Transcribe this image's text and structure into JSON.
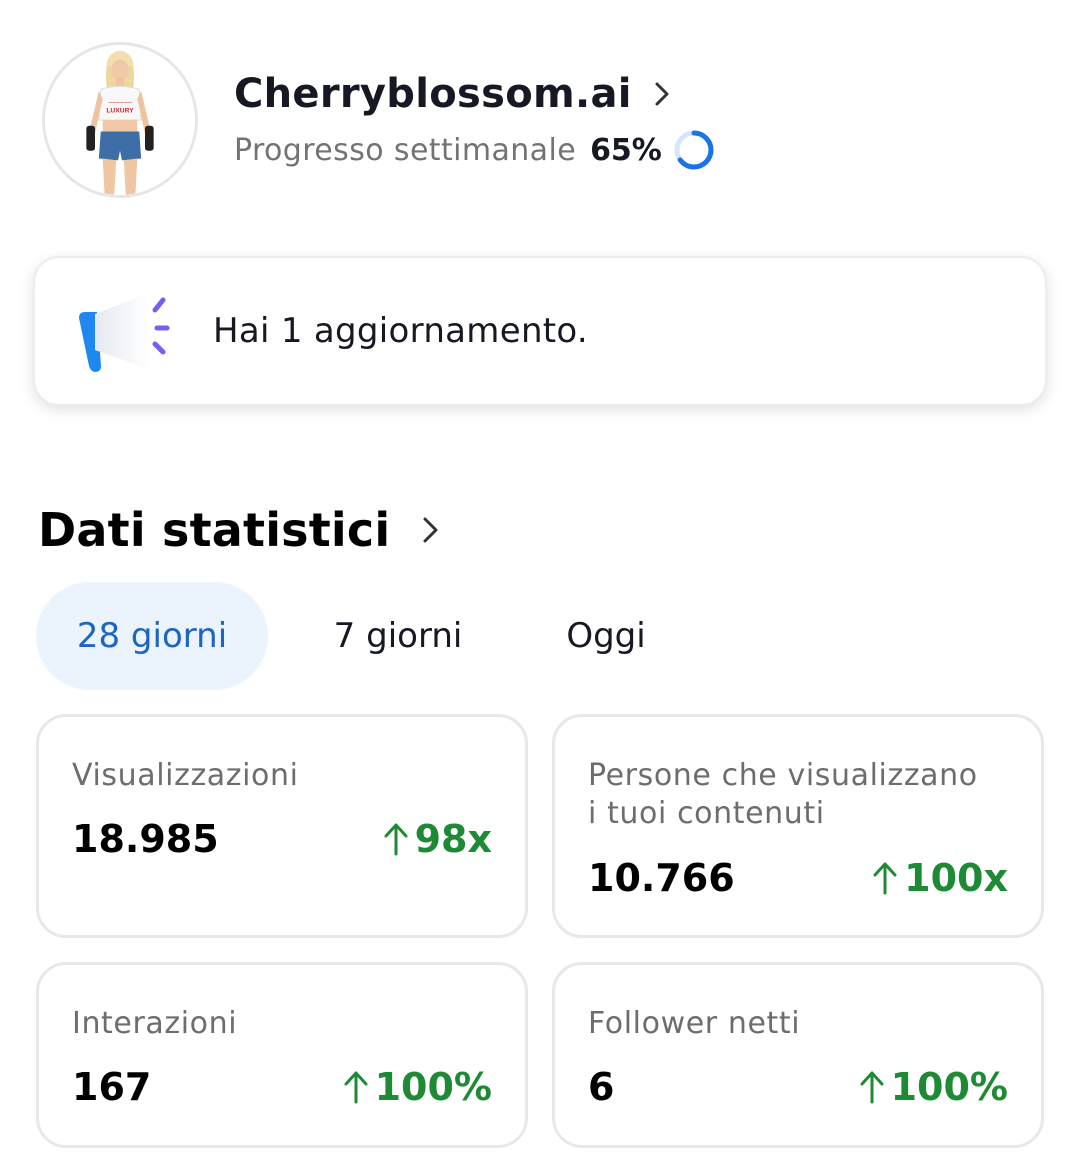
{
  "profile": {
    "name": "Cherryblossom.ai",
    "progress_label": "Progresso settimanale",
    "progress_value": "65%",
    "progress_fraction": 0.65,
    "avatar_shirt_text": "LUXURY"
  },
  "banner": {
    "icon": "megaphone-icon",
    "text": "Hai 1 aggiornamento."
  },
  "stats": {
    "title": "Dati statistici",
    "tabs": [
      {
        "label": "28 giorni",
        "active": true
      },
      {
        "label": "7 giorni",
        "active": false
      },
      {
        "label": "Oggi",
        "active": false
      }
    ],
    "cards": [
      {
        "label": "Visualizzazioni",
        "value": "18.985",
        "change": "98x"
      },
      {
        "label": "Persone che visualizzano i tuoi contenuti",
        "label_line1": "Persone che visualizzano",
        "label_line2": "i tuoi contenuti",
        "value": "10.766",
        "change": "100x"
      },
      {
        "label": "Interazioni",
        "value": "167",
        "change": "100%"
      },
      {
        "label": "Follower netti",
        "value": "6",
        "change": "100%"
      }
    ]
  },
  "colors": {
    "accent_blue": "#1c65c4",
    "tab_active_bg": "#ebf3fc",
    "positive_green": "#1e8a36",
    "secondary_text": "#737373"
  }
}
